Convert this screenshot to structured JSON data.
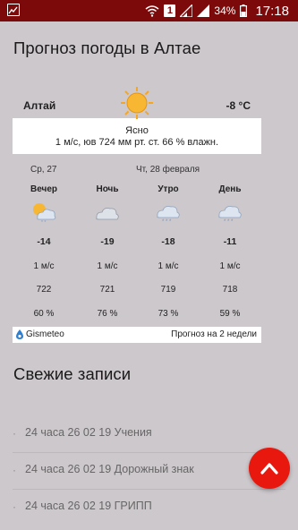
{
  "status_bar": {
    "battery_percent": "34%",
    "time": "17:18",
    "sim_slot": "1"
  },
  "weather": {
    "title": "Прогноз погоды в Алтае",
    "city": "Алтай",
    "current_temp": "-8 °C",
    "condition": "Ясно",
    "details": "1 м/с, юв  724 мм рт. ст.  66 % влажн.",
    "day1": "Ср, 27",
    "day2": "Чт, 28 февраля",
    "periods": [
      {
        "label": "Вечер",
        "icon": "partly-cloudy-snow-icon",
        "temp": "-14",
        "wind": "1 м/с",
        "pressure": "722",
        "humidity": "60 %"
      },
      {
        "label": "Ночь",
        "icon": "cloudy-icon",
        "temp": "-19",
        "wind": "1 м/с",
        "pressure": "721",
        "humidity": "76 %"
      },
      {
        "label": "Утро",
        "icon": "cloudy-snow-icon",
        "temp": "-18",
        "wind": "1 м/с",
        "pressure": "719",
        "humidity": "73 %"
      },
      {
        "label": "День",
        "icon": "cloudy-snow-icon",
        "temp": "-11",
        "wind": "1 м/с",
        "pressure": "718",
        "humidity": "59 %"
      }
    ],
    "provider": "Gismeteo",
    "two_weeks_link": "Прогноз на 2 недели"
  },
  "recent": {
    "title": "Свежие записи",
    "items": [
      "24 часа 26 02 19 Учения",
      "24 часа 26 02 19 Дорожный знак",
      "24 часа 26 02 19 ГРИПП"
    ]
  },
  "colors": {
    "status_bar": "#7d0a0a",
    "background": "#cdc8cc",
    "fab": "#e8180f",
    "sun": "#f5a623"
  }
}
